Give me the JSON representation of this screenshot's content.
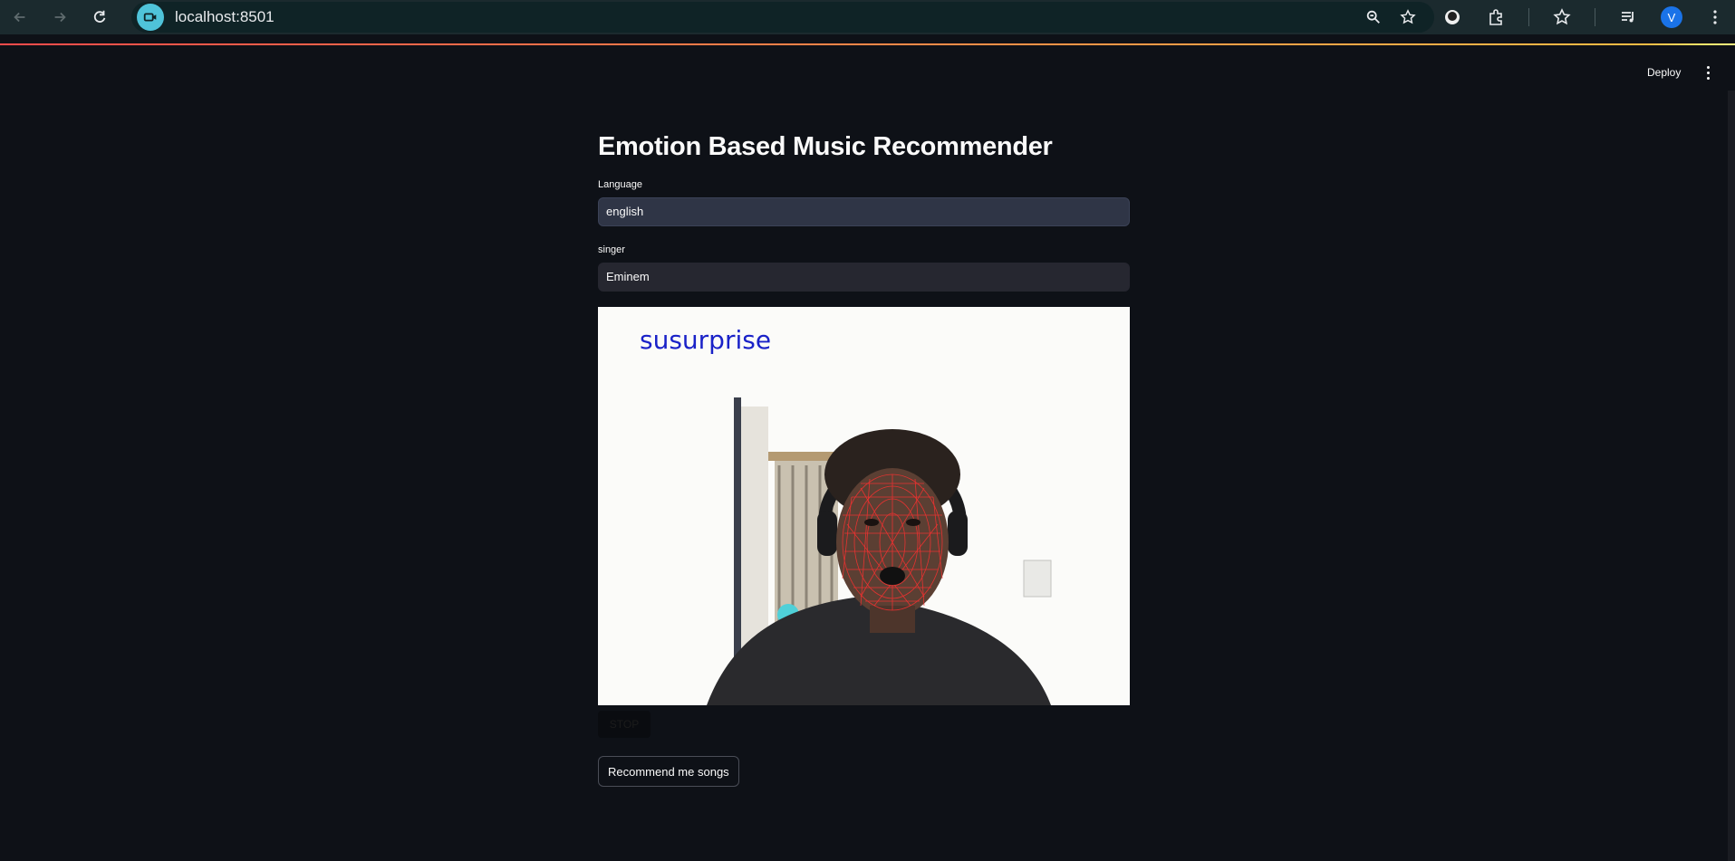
{
  "browser": {
    "url": "localhost:8501",
    "profile_initial": "V"
  },
  "header": {
    "deploy_label": "Deploy"
  },
  "main": {
    "title": "Emotion Based Music Recommender",
    "language_label": "Language",
    "language_value": "english",
    "singer_label": "singer",
    "singer_value": "Eminem",
    "emotion_overlay": "susurprise",
    "stop_label": "STOP",
    "recommend_label": "Recommend me songs"
  },
  "colors": {
    "background": "#0e1117",
    "input_bg": "#262730",
    "emotion_text": "#1a22c8",
    "accent_red": "#ff4b4b"
  }
}
